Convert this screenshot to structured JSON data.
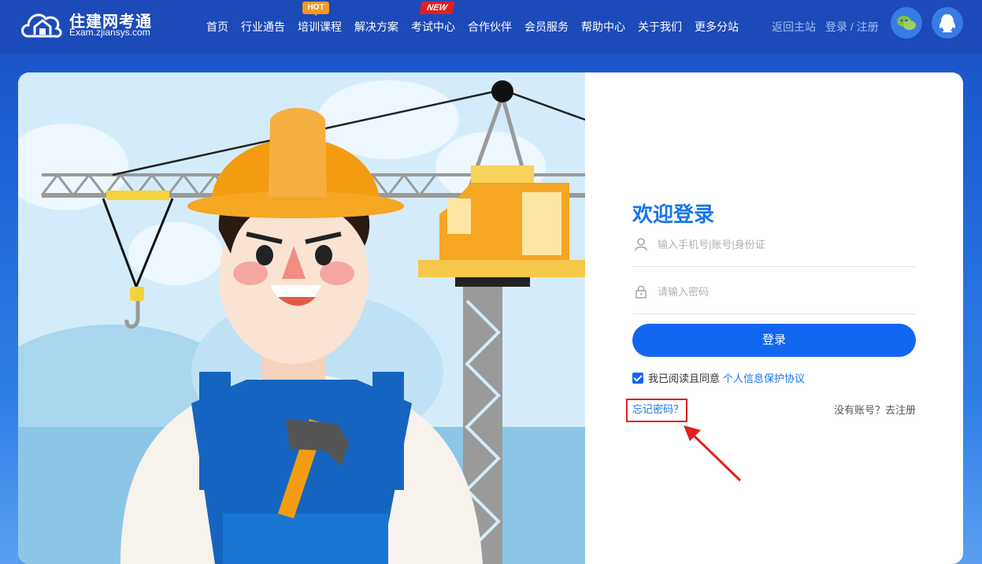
{
  "header": {
    "logo_title": "住建网考通",
    "logo_sub": "Exam.zjiansys.com",
    "nav": [
      {
        "label": "首页"
      },
      {
        "label": "行业通告"
      },
      {
        "label": "培训课程",
        "badge": "HOT"
      },
      {
        "label": "解决方案"
      },
      {
        "label": "考试中心",
        "badge": "NEW"
      },
      {
        "label": "合作伙伴"
      },
      {
        "label": "会员服务"
      },
      {
        "label": "帮助中心"
      },
      {
        "label": "关于我们"
      },
      {
        "label": "更多分站"
      }
    ],
    "return_main": "返回主站",
    "login_register": "登录 / 注册",
    "icons": [
      "wechat-icon",
      "qq-icon"
    ]
  },
  "login": {
    "title": "欢迎登录",
    "account_placeholder": "输入手机号|账号|身份证",
    "password_placeholder": "请输入密码",
    "login_button": "登录",
    "agree_text": "我已阅读且同意",
    "agree_link": "个人信息保护协议",
    "agree_checked": true,
    "forgot": "忘记密码？",
    "register": "没有账号？去注册"
  },
  "colors": {
    "accent": "#1166f0",
    "header_bg": "#1c4ab8",
    "highlight": "#e02020"
  }
}
